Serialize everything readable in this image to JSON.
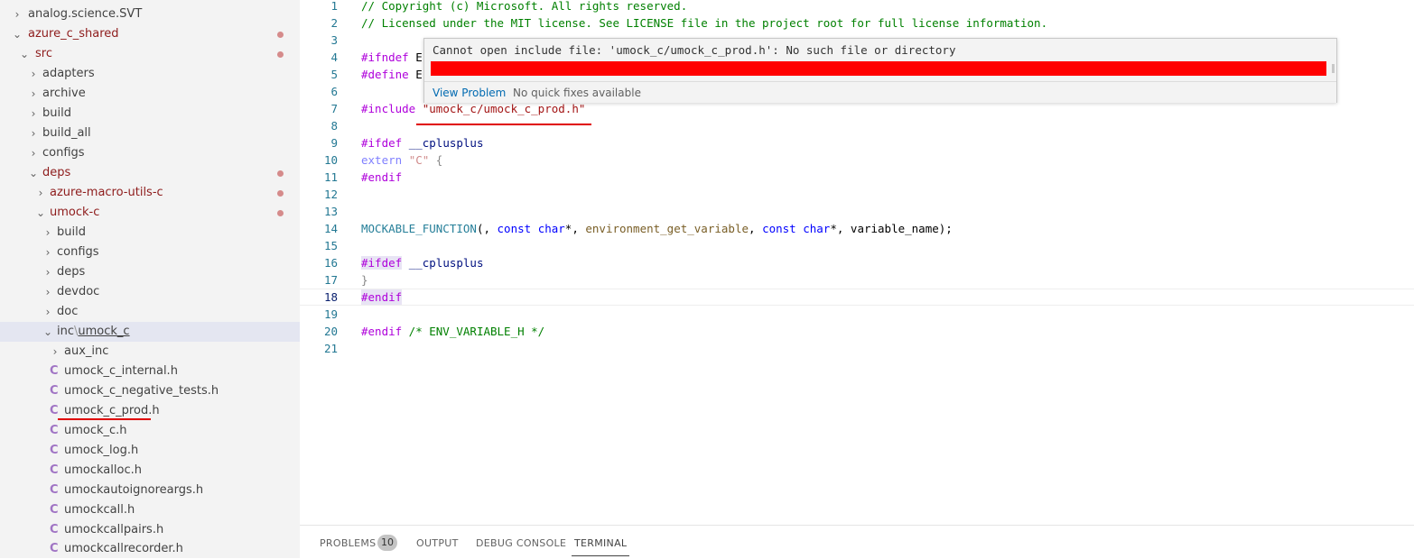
{
  "sidebar": {
    "items": [
      {
        "label": "analog.science.SVT",
        "kind": "folder",
        "expanded": false
      },
      {
        "label": "azure_c_shared",
        "kind": "folder",
        "expanded": true,
        "modified": true
      },
      {
        "label": "src",
        "kind": "folder",
        "expanded": true,
        "modified": true
      },
      {
        "label": "adapters",
        "kind": "folder",
        "expanded": false
      },
      {
        "label": "archive",
        "kind": "folder",
        "expanded": false
      },
      {
        "label": "build",
        "kind": "folder",
        "expanded": false
      },
      {
        "label": "build_all",
        "kind": "folder",
        "expanded": false
      },
      {
        "label": "configs",
        "kind": "folder",
        "expanded": false
      },
      {
        "label": "deps",
        "kind": "folder",
        "expanded": true,
        "modified": true
      },
      {
        "label": "azure-macro-utils-c",
        "kind": "folder",
        "expanded": false,
        "modified": true
      },
      {
        "label": "umock-c",
        "kind": "folder",
        "expanded": true,
        "modified": true
      },
      {
        "label": "build",
        "kind": "folder",
        "expanded": false
      },
      {
        "label": "configs",
        "kind": "folder",
        "expanded": false
      },
      {
        "label": "deps",
        "kind": "folder",
        "expanded": false
      },
      {
        "label": "devdoc",
        "kind": "folder",
        "expanded": false
      },
      {
        "label": "doc",
        "kind": "folder",
        "expanded": false
      },
      {
        "label": "inc",
        "label2": "umock_c",
        "separator": "\\",
        "kind": "folder",
        "expanded": true
      },
      {
        "label": "aux_inc",
        "kind": "folder",
        "expanded": false
      },
      {
        "label": "umock_c_internal.h",
        "kind": "file",
        "icon": "C"
      },
      {
        "label": "umock_c_negative_tests.h",
        "kind": "file",
        "icon": "C"
      },
      {
        "label": "umock_c_prod.h",
        "kind": "file",
        "icon": "C"
      },
      {
        "label": "umock_c.h",
        "kind": "file",
        "icon": "C"
      },
      {
        "label": "umock_log.h",
        "kind": "file",
        "icon": "C"
      },
      {
        "label": "umockalloc.h",
        "kind": "file",
        "icon": "C"
      },
      {
        "label": "umockautoignoreargs.h",
        "kind": "file",
        "icon": "C"
      },
      {
        "label": "umockcall.h",
        "kind": "file",
        "icon": "C"
      },
      {
        "label": "umockcallpairs.h",
        "kind": "file",
        "icon": "C"
      },
      {
        "label": "umockcallrecorder.h",
        "kind": "file",
        "icon": "C"
      }
    ]
  },
  "editor": {
    "line_numbers": [
      "1",
      "2",
      "3",
      "4",
      "5",
      "6",
      "7",
      "8",
      "9",
      "10",
      "11",
      "12",
      "13",
      "14",
      "15",
      "16",
      "17",
      "18",
      "19",
      "20",
      "21"
    ],
    "current_line": "18",
    "lines": {
      "l1": "// Copyright (c) Microsoft. All rights reserved.",
      "l2": "// Licensed under the MIT license. See LICENSE file in the project root for full license information.",
      "l4_kw": "#ifndef",
      "l4_rest": " E",
      "l5_kw": "#define",
      "l5_rest": " E",
      "l7_kw": "#include",
      "l7_str": "\"umock_c/umock_c_prod.h\"",
      "l9_kw": "#ifdef",
      "l9_id": "__cplusplus",
      "l10_kw": "extern",
      "l10_str": "\"C\"",
      "l10_rest": " {",
      "l11_kw": "#endif",
      "l14_fn": "MOCKABLE_FUNCTION",
      "l14_a": "(, ",
      "l14_const1": "const",
      "l14_char1": "char",
      "l14_b": "*, ",
      "l14_name": "environment_get_variable",
      "l14_c": ", ",
      "l14_const2": "const",
      "l14_char2": "char",
      "l14_d": "*, ",
      "l14_param": "variable_name",
      "l14_e": ");",
      "l16_kw": "#ifdef",
      "l16_id": "__cplusplus",
      "l17": "}",
      "l18_kw": "#endif",
      "l20_kw": "#endif",
      "l20_cm": " /* ENV_VARIABLE_H */"
    }
  },
  "hover": {
    "message": "Cannot open include file: 'umock_c/umock_c_prod.h': No such file or directory",
    "view_problem": "View Problem",
    "no_quick_fixes": "No quick fixes available"
  },
  "panel": {
    "tabs": [
      {
        "label": "PROBLEMS",
        "active": false
      },
      {
        "label": "OUTPUT",
        "active": false
      },
      {
        "label": "DEBUG CONSOLE",
        "active": false
      },
      {
        "label": "TERMINAL",
        "active": true
      }
    ],
    "problems_count": "10"
  },
  "colors": {
    "modified": "#8e1c1c",
    "error": "#e00000",
    "redaction": "#ff0000",
    "link": "#006ab1"
  }
}
